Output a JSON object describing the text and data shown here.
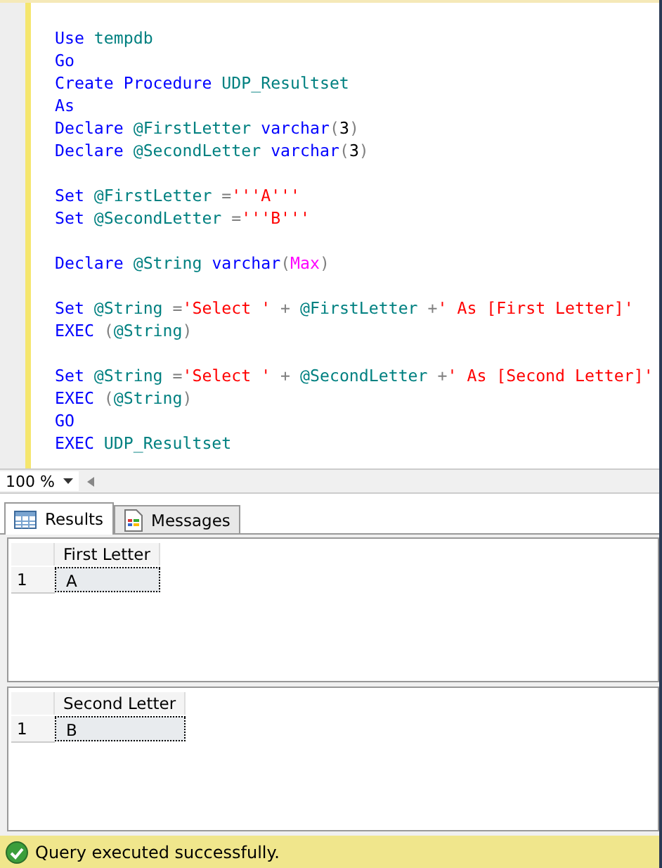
{
  "editor": {
    "lines": [
      {
        "tokens": [
          {
            "t": "Use",
            "kind": "keyword"
          },
          {
            "t": " tempdb",
            "kind": "identifier"
          }
        ]
      },
      {
        "tokens": [
          {
            "t": "Go",
            "kind": "keyword"
          }
        ]
      },
      {
        "tokens": [
          {
            "t": "Create Procedure ",
            "kind": "keyword"
          },
          {
            "t": "UDP_Resultset",
            "kind": "identifier"
          }
        ]
      },
      {
        "tokens": [
          {
            "t": "As",
            "kind": "keyword"
          }
        ]
      },
      {
        "tokens": [
          {
            "t": "Declare ",
            "kind": "keyword"
          },
          {
            "t": "@FirstLetter ",
            "kind": "variable"
          },
          {
            "t": "varchar",
            "kind": "keyword"
          },
          {
            "t": "(",
            "kind": "operator"
          },
          {
            "t": "3",
            "kind": "number"
          },
          {
            "t": ")",
            "kind": "operator"
          }
        ]
      },
      {
        "tokens": [
          {
            "t": "Declare ",
            "kind": "keyword"
          },
          {
            "t": "@SecondLetter ",
            "kind": "variable"
          },
          {
            "t": "varchar",
            "kind": "keyword"
          },
          {
            "t": "(",
            "kind": "operator"
          },
          {
            "t": "3",
            "kind": "number"
          },
          {
            "t": ")",
            "kind": "operator"
          }
        ]
      },
      {
        "gap_before": true,
        "tokens": [
          {
            "t": "Set ",
            "kind": "keyword"
          },
          {
            "t": "@FirstLetter ",
            "kind": "variable"
          },
          {
            "t": "=",
            "kind": "operator"
          },
          {
            "t": "'''A'''",
            "kind": "string"
          }
        ]
      },
      {
        "tokens": [
          {
            "t": "Set ",
            "kind": "keyword"
          },
          {
            "t": "@SecondLetter ",
            "kind": "variable"
          },
          {
            "t": "=",
            "kind": "operator"
          },
          {
            "t": "'''B'''",
            "kind": "string"
          }
        ]
      },
      {
        "gap_before": true,
        "tokens": [
          {
            "t": "Declare ",
            "kind": "keyword"
          },
          {
            "t": "@String ",
            "kind": "variable"
          },
          {
            "t": "varchar",
            "kind": "keyword"
          },
          {
            "t": "(",
            "kind": "operator"
          },
          {
            "t": "Max",
            "kind": "function"
          },
          {
            "t": ")",
            "kind": "operator"
          }
        ]
      },
      {
        "gap_before": true,
        "tokens": [
          {
            "t": "Set ",
            "kind": "keyword"
          },
          {
            "t": "@String ",
            "kind": "variable"
          },
          {
            "t": "=",
            "kind": "operator"
          },
          {
            "t": "'Select '",
            "kind": "string"
          },
          {
            "t": " + ",
            "kind": "operator"
          },
          {
            "t": "@FirstLetter ",
            "kind": "variable"
          },
          {
            "t": "+",
            "kind": "operator"
          },
          {
            "t": "' As [First Letter]'",
            "kind": "string"
          }
        ]
      },
      {
        "tokens": [
          {
            "t": "EXEC ",
            "kind": "keyword"
          },
          {
            "t": "(",
            "kind": "operator"
          },
          {
            "t": "@String",
            "kind": "variable"
          },
          {
            "t": ")",
            "kind": "operator"
          }
        ]
      },
      {
        "gap_before": true,
        "tokens": [
          {
            "t": "Set ",
            "kind": "keyword"
          },
          {
            "t": "@String ",
            "kind": "variable"
          },
          {
            "t": "=",
            "kind": "operator"
          },
          {
            "t": "'Select '",
            "kind": "string"
          },
          {
            "t": " + ",
            "kind": "operator"
          },
          {
            "t": "@SecondLetter ",
            "kind": "variable"
          },
          {
            "t": "+",
            "kind": "operator"
          },
          {
            "t": "' As [Second Letter]'",
            "kind": "string"
          }
        ]
      },
      {
        "tokens": [
          {
            "t": "EXEC ",
            "kind": "keyword"
          },
          {
            "t": "(",
            "kind": "operator"
          },
          {
            "t": "@String",
            "kind": "variable"
          },
          {
            "t": ")",
            "kind": "operator"
          }
        ]
      },
      {
        "tokens": [
          {
            "t": "GO",
            "kind": "keyword"
          }
        ]
      },
      {
        "tokens": [
          {
            "t": "EXEC ",
            "kind": "keyword"
          },
          {
            "t": "UDP_Resultset",
            "kind": "identifier"
          }
        ]
      }
    ]
  },
  "zoom": {
    "value": "100 %"
  },
  "tabs": [
    {
      "label": "Results",
      "kind": "grid",
      "selected": true
    },
    {
      "label": "Messages",
      "kind": "messages",
      "selected": false
    }
  ],
  "grids": [
    {
      "column": "First Letter",
      "rows": [
        {
          "number": "1",
          "cell": "A",
          "selected": true
        }
      ]
    },
    {
      "column": "Second Letter",
      "rows": [
        {
          "number": "1",
          "cell": "B",
          "selected": true
        }
      ]
    }
  ],
  "status_bar": {
    "text": "Query executed successfully."
  }
}
